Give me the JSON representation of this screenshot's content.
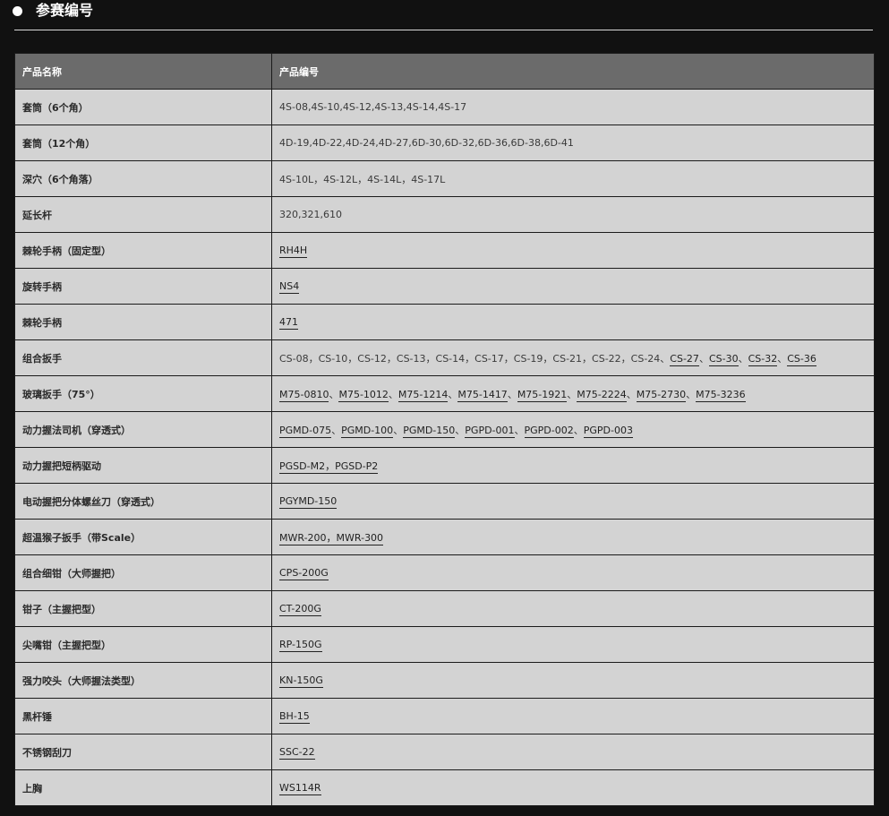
{
  "section": {
    "title": "参赛编号"
  },
  "table": {
    "headers": [
      "产品名称",
      "产品编号"
    ],
    "rows": [
      {
        "name": "套筒（6个角）",
        "segments": [
          {
            "text": "4S-08,4S-10,4S-12,4S-13,4S-14,4S-17",
            "link": false
          }
        ]
      },
      {
        "name": "套筒（12个角）",
        "segments": [
          {
            "text": "4D-19,4D-22,4D-24,4D-27,6D-30,6D-32,6D-36,6D-38,6D-41",
            "link": false
          }
        ]
      },
      {
        "name": "深穴（6个角落）",
        "segments": [
          {
            "text": "4S-10L，4S-12L，4S-14L，4S-17L",
            "link": false
          }
        ]
      },
      {
        "name": "延长杆",
        "segments": [
          {
            "text": "320,321,610",
            "link": false
          }
        ]
      },
      {
        "name": "棘轮手柄（固定型）",
        "segments": [
          {
            "text": "RH4H",
            "link": true
          }
        ]
      },
      {
        "name": "旋转手柄",
        "segments": [
          {
            "text": "NS4",
            "link": true
          }
        ]
      },
      {
        "name": "棘轮手柄",
        "segments": [
          {
            "text": "471",
            "link": true
          }
        ]
      },
      {
        "name": "组合扳手",
        "segments": [
          {
            "text": "CS-08，CS-10，CS-12，CS-13，CS-14，CS-17，CS-19，CS-21，CS-22，CS-24",
            "link": false
          },
          {
            "text": "、",
            "link": false
          },
          {
            "text": "CS-27",
            "link": true
          },
          {
            "text": "、",
            "link": false
          },
          {
            "text": "CS-30",
            "link": true
          },
          {
            "text": "、",
            "link": false
          },
          {
            "text": "CS-32",
            "link": true
          },
          {
            "text": "、",
            "link": false
          },
          {
            "text": "CS-36",
            "link": true
          }
        ]
      },
      {
        "name": "玻璃扳手（75°）",
        "segments": [
          {
            "text": "M75-0810",
            "link": true
          },
          {
            "text": "、",
            "link": false
          },
          {
            "text": "M75-1012",
            "link": true
          },
          {
            "text": "、",
            "link": false
          },
          {
            "text": "M75-1214",
            "link": true
          },
          {
            "text": "、",
            "link": false
          },
          {
            "text": "M75-1417",
            "link": true
          },
          {
            "text": "、",
            "link": false
          },
          {
            "text": "M75-1921",
            "link": true
          },
          {
            "text": "、",
            "link": false
          },
          {
            "text": "M75-2224",
            "link": true
          },
          {
            "text": "、",
            "link": false
          },
          {
            "text": "M75-2730",
            "link": true
          },
          {
            "text": "、",
            "link": false
          },
          {
            "text": "M75-3236",
            "link": true
          }
        ]
      },
      {
        "name": "动力握法司机（穿透式）",
        "segments": [
          {
            "text": "PGMD-075",
            "link": true
          },
          {
            "text": "、",
            "link": false
          },
          {
            "text": "PGMD-100",
            "link": true
          },
          {
            "text": "、",
            "link": false
          },
          {
            "text": "PGMD-150",
            "link": true
          },
          {
            "text": "、",
            "link": false
          },
          {
            "text": "PGPD-001",
            "link": true
          },
          {
            "text": "、",
            "link": false
          },
          {
            "text": "PGPD-002",
            "link": true
          },
          {
            "text": "、",
            "link": false
          },
          {
            "text": "PGPD-003",
            "link": true
          }
        ]
      },
      {
        "name": "动力握把短柄驱动",
        "segments": [
          {
            "text": "PGSD-M2，PGSD-P2",
            "link": true
          }
        ]
      },
      {
        "name": "电动握把分体螺丝刀（穿透式）",
        "segments": [
          {
            "text": "PGYMD-150",
            "link": true
          }
        ]
      },
      {
        "name": "超温猴子扳手（带Scale）",
        "segments": [
          {
            "text": "MWR-200，MWR-300",
            "link": true
          }
        ]
      },
      {
        "name": "组合细钳（大师握把）",
        "segments": [
          {
            "text": "CPS-200G",
            "link": true
          }
        ]
      },
      {
        "name": "钳子（主握把型）",
        "segments": [
          {
            "text": "CT-200G",
            "link": true
          }
        ]
      },
      {
        "name": "尖嘴钳（主握把型）",
        "segments": [
          {
            "text": "RP-150G",
            "link": true
          }
        ]
      },
      {
        "name": "强力咬头（大师握法类型）",
        "segments": [
          {
            "text": "KN-150G",
            "link": true
          }
        ]
      },
      {
        "name": "黑杆锤",
        "segments": [
          {
            "text": "BH-15",
            "link": true
          }
        ]
      },
      {
        "name": "不锈钢刮刀",
        "segments": [
          {
            "text": "SSC-22",
            "link": true
          }
        ]
      },
      {
        "name": "上胸",
        "segments": [
          {
            "text": "WS114R",
            "link": true
          }
        ]
      }
    ]
  }
}
